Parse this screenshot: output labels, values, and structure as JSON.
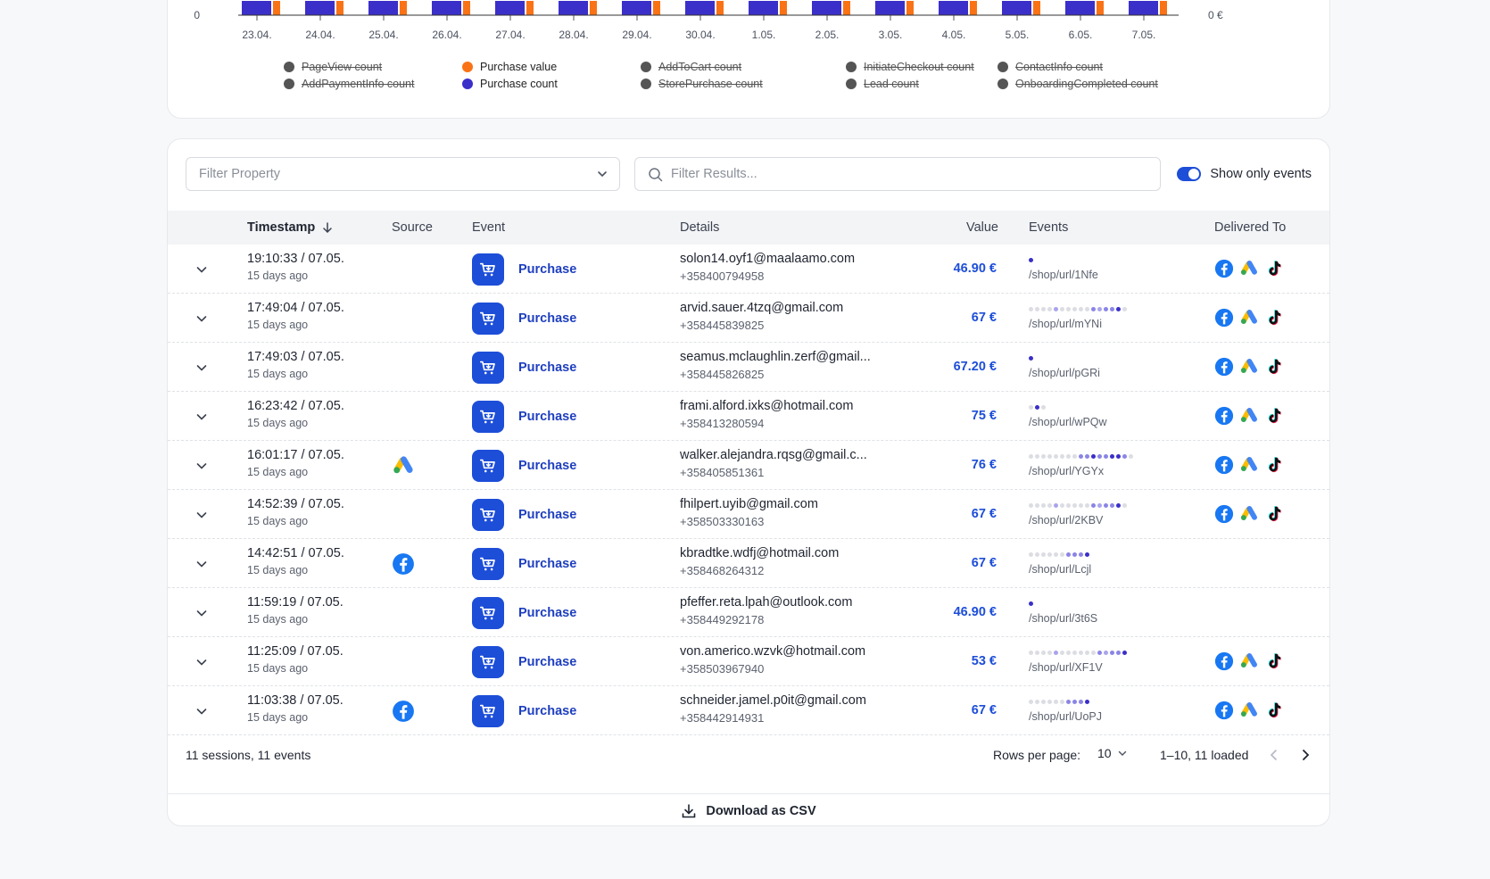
{
  "chart_data": {
    "type": "bar",
    "categories": [
      "23.04.",
      "24.04.",
      "25.04.",
      "26.04.",
      "27.04.",
      "28.04.",
      "29.04.",
      "30.04.",
      "1.05.",
      "2.05.",
      "3.05.",
      "4.05.",
      "5.05.",
      "6.05.",
      "7.05."
    ],
    "left_axis_ticks": [
      "0"
    ],
    "right_axis_ticks": [
      "0 €"
    ],
    "series": [
      {
        "name": "Purchase count",
        "color": "#3b2fc9",
        "visible": true
      },
      {
        "name": "Purchase value",
        "color": "#f97316",
        "visible": true
      }
    ],
    "legend_placement": "bottom",
    "legend": [
      {
        "label": "PageView count",
        "color": "#555555",
        "visible": false
      },
      {
        "label": "Purchase value",
        "color": "#f97316",
        "visible": true
      },
      {
        "label": "AddToCart count",
        "color": "#555555",
        "visible": false
      },
      {
        "label": "InitiateCheckout count",
        "color": "#555555",
        "visible": false
      },
      {
        "label": "ContactInfo count",
        "color": "#555555",
        "visible": false
      },
      {
        "label": "AddPaymentInfo count",
        "color": "#555555",
        "visible": false
      },
      {
        "label": "Purchase count",
        "color": "#3b2fc9",
        "visible": true
      },
      {
        "label": "StorePurchase count",
        "color": "#555555",
        "visible": false
      },
      {
        "label": "Lead count",
        "color": "#555555",
        "visible": false
      },
      {
        "label": "OnboardingCompleted count",
        "color": "#555555",
        "visible": false
      }
    ]
  },
  "toolbar": {
    "filter_property_placeholder": "Filter Property",
    "filter_results_placeholder": "Filter Results...",
    "show_only_events_label": "Show only events",
    "show_only_events_on": true
  },
  "columns": {
    "timestamp": "Timestamp",
    "source": "Source",
    "event": "Event",
    "details": "Details",
    "value": "Value",
    "events": "Events",
    "delivered_to": "Delivered To"
  },
  "rows": [
    {
      "time": "19:10:33 / 07.05.",
      "ago": "15 days ago",
      "source": "",
      "event": "Purchase",
      "email": "solon14.oyf1@maalaamo.com",
      "phone": "+358400794958",
      "value": "46.90 €",
      "path": "/shop/url/1Nfe",
      "dots": "D",
      "delivered": [
        "facebook-icon",
        "google-ads-icon",
        "tiktok-icon"
      ]
    },
    {
      "time": "17:49:04 / 07.05.",
      "ago": "15 days ago",
      "source": "",
      "event": "Purchase",
      "email": "arvid.sauer.4tzq@gmail.com",
      "phone": "+358445839825",
      "value": "67 €",
      "path": "/shop/url/mYNi",
      "dots": "llllMlllllLMLLDl",
      "delivered": [
        "facebook-icon",
        "google-ads-icon",
        "tiktok-icon"
      ]
    },
    {
      "time": "17:49:03 / 07.05.",
      "ago": "15 days ago",
      "source": "",
      "event": "Purchase",
      "email": "seamus.mclaughlin.zerf@gmail...",
      "phone": "+358445826825",
      "value": "67.20 €",
      "path": "/shop/url/pGRi",
      "dots": "D",
      "delivered": [
        "facebook-icon",
        "google-ads-icon",
        "tiktok-icon"
      ]
    },
    {
      "time": "16:23:42 / 07.05.",
      "ago": "15 days ago",
      "source": "",
      "event": "Purchase",
      "email": "frami.alford.ixks@hotmail.com",
      "phone": "+358413280594",
      "value": "75 €",
      "path": "/shop/url/wPQw",
      "dots": "lDl",
      "delivered": [
        "facebook-icon",
        "google-ads-icon",
        "tiktok-icon"
      ]
    },
    {
      "time": "16:01:17 / 07.05.",
      "ago": "15 days ago",
      "source": "google-ads-icon",
      "event": "Purchase",
      "email": "walker.alejandra.rqsg@gmail.c...",
      "phone": "+358405851361",
      "value": "76 €",
      "path": "/shop/url/YGYx",
      "dots": "llllllllLLDLLDDLl",
      "delivered": [
        "facebook-icon",
        "google-ads-icon",
        "tiktok-icon"
      ]
    },
    {
      "time": "14:52:39 / 07.05.",
      "ago": "15 days ago",
      "source": "",
      "event": "Purchase",
      "email": "fhilpert.uyib@gmail.com",
      "phone": "+358503330163",
      "value": "67 €",
      "path": "/shop/url/2KBV",
      "dots": "llllMlllllLMLLDl",
      "delivered": [
        "facebook-icon",
        "google-ads-icon",
        "tiktok-icon"
      ]
    },
    {
      "time": "14:42:51 / 07.05.",
      "ago": "15 days ago",
      "source": "facebook-icon",
      "event": "Purchase",
      "email": "kbradtke.wdfj@hotmail.com",
      "phone": "+358468264312",
      "value": "67 €",
      "path": "/shop/url/Lcjl",
      "dots": "llllllLLLD",
      "delivered": []
    },
    {
      "time": "11:59:19 / 07.05.",
      "ago": "15 days ago",
      "source": "",
      "event": "Purchase",
      "email": "pfeffer.reta.lpah@outlook.com",
      "phone": "+358449292178",
      "value": "46.90 €",
      "path": "/shop/url/3t6S",
      "dots": "D",
      "delivered": []
    },
    {
      "time": "11:25:09 / 07.05.",
      "ago": "15 days ago",
      "source": "",
      "event": "Purchase",
      "email": "von.americo.wzvk@hotmail.com",
      "phone": "+358503967940",
      "value": "53 €",
      "path": "/shop/url/XF1V",
      "dots": "llllMllllllLMLLD",
      "delivered": [
        "facebook-icon",
        "google-ads-icon",
        "tiktok-icon"
      ]
    },
    {
      "time": "11:03:38 / 07.05.",
      "ago": "15 days ago",
      "source": "facebook-icon",
      "event": "Purchase",
      "email": "schneider.jamel.p0it@gmail.com",
      "phone": "+358442914931",
      "value": "67 €",
      "path": "/shop/url/UoPJ",
      "dots": "llllllLLLD",
      "delivered": [
        "facebook-icon",
        "google-ads-icon",
        "tiktok-icon"
      ]
    }
  ],
  "footer": {
    "summary": "11 sessions, 11 events",
    "rows_per_page_label": "Rows per page:",
    "rows_per_page_value": "10",
    "range": "1–10, 11 loaded",
    "download_label": "Download as CSV"
  },
  "colors": {
    "accent": "#1d4ed8",
    "purchase_count": "#3b2fc9",
    "purchase_value": "#f97316"
  }
}
